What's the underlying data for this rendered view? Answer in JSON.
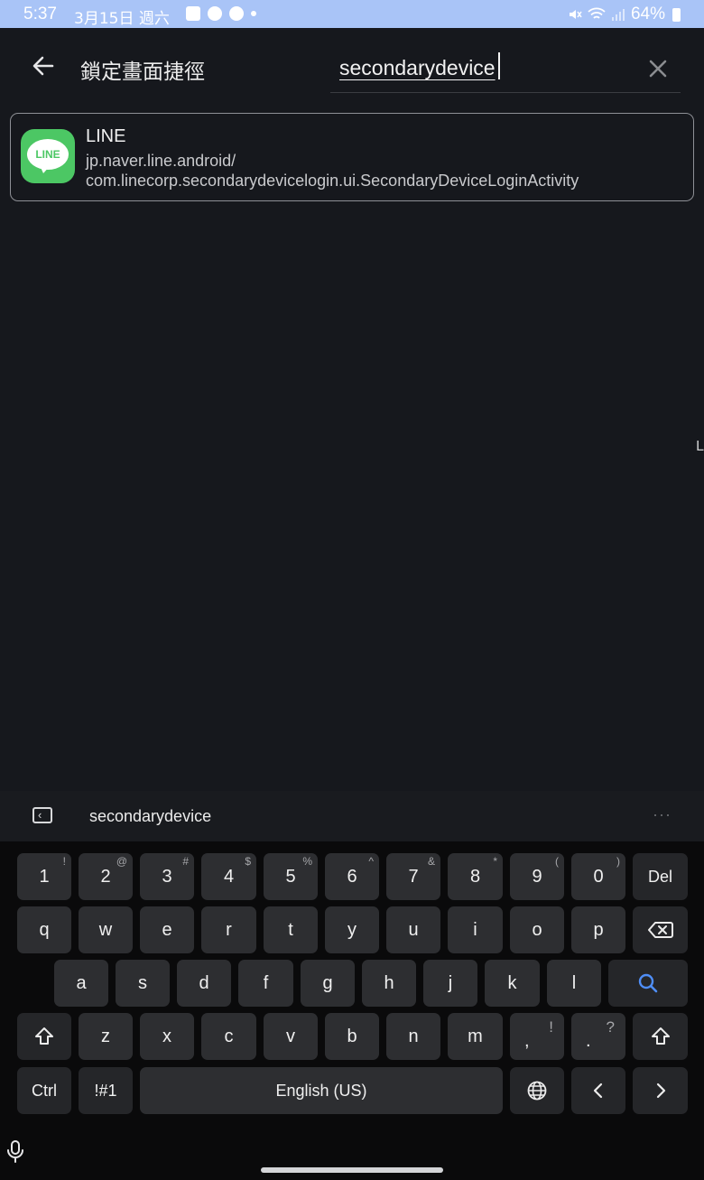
{
  "status_bar": {
    "time": "5:37",
    "date": "3月15日 週六",
    "battery": "64%"
  },
  "header": {
    "title": "鎖定畫面捷徑",
    "search_value": "secondarydevice"
  },
  "result": {
    "app_name": "LINE",
    "logo_text": "LINE",
    "package_line1": "jp.naver.line.android/",
    "package_line2": "com.linecorp.secondarydevicelogin.ui.SecondaryDeviceLoginActivity"
  },
  "edge_letter": "L",
  "keyboard": {
    "suggestion": "secondarydevice",
    "row1": [
      {
        "label": "1",
        "hint": "!"
      },
      {
        "label": "2",
        "hint": "@"
      },
      {
        "label": "3",
        "hint": "#"
      },
      {
        "label": "4",
        "hint": "$"
      },
      {
        "label": "5",
        "hint": "%"
      },
      {
        "label": "6",
        "hint": "^"
      },
      {
        "label": "7",
        "hint": "&"
      },
      {
        "label": "8",
        "hint": "*"
      },
      {
        "label": "9",
        "hint": "("
      },
      {
        "label": "0",
        "hint": ")"
      }
    ],
    "del_label": "Del",
    "row2": [
      "q",
      "w",
      "e",
      "r",
      "t",
      "y",
      "u",
      "i",
      "o",
      "p"
    ],
    "row3": [
      "a",
      "s",
      "d",
      "f",
      "g",
      "h",
      "j",
      "k",
      "l"
    ],
    "row4": [
      "z",
      "x",
      "c",
      "v",
      "b",
      "n",
      "m"
    ],
    "comma": {
      "label": ",",
      "hint": "!"
    },
    "period": {
      "label": ".",
      "hint": "?"
    },
    "ctrl_label": "Ctrl",
    "symbols_label": "!#1",
    "space_label": "English (US)",
    "accent_color": "#4f8ef7"
  }
}
